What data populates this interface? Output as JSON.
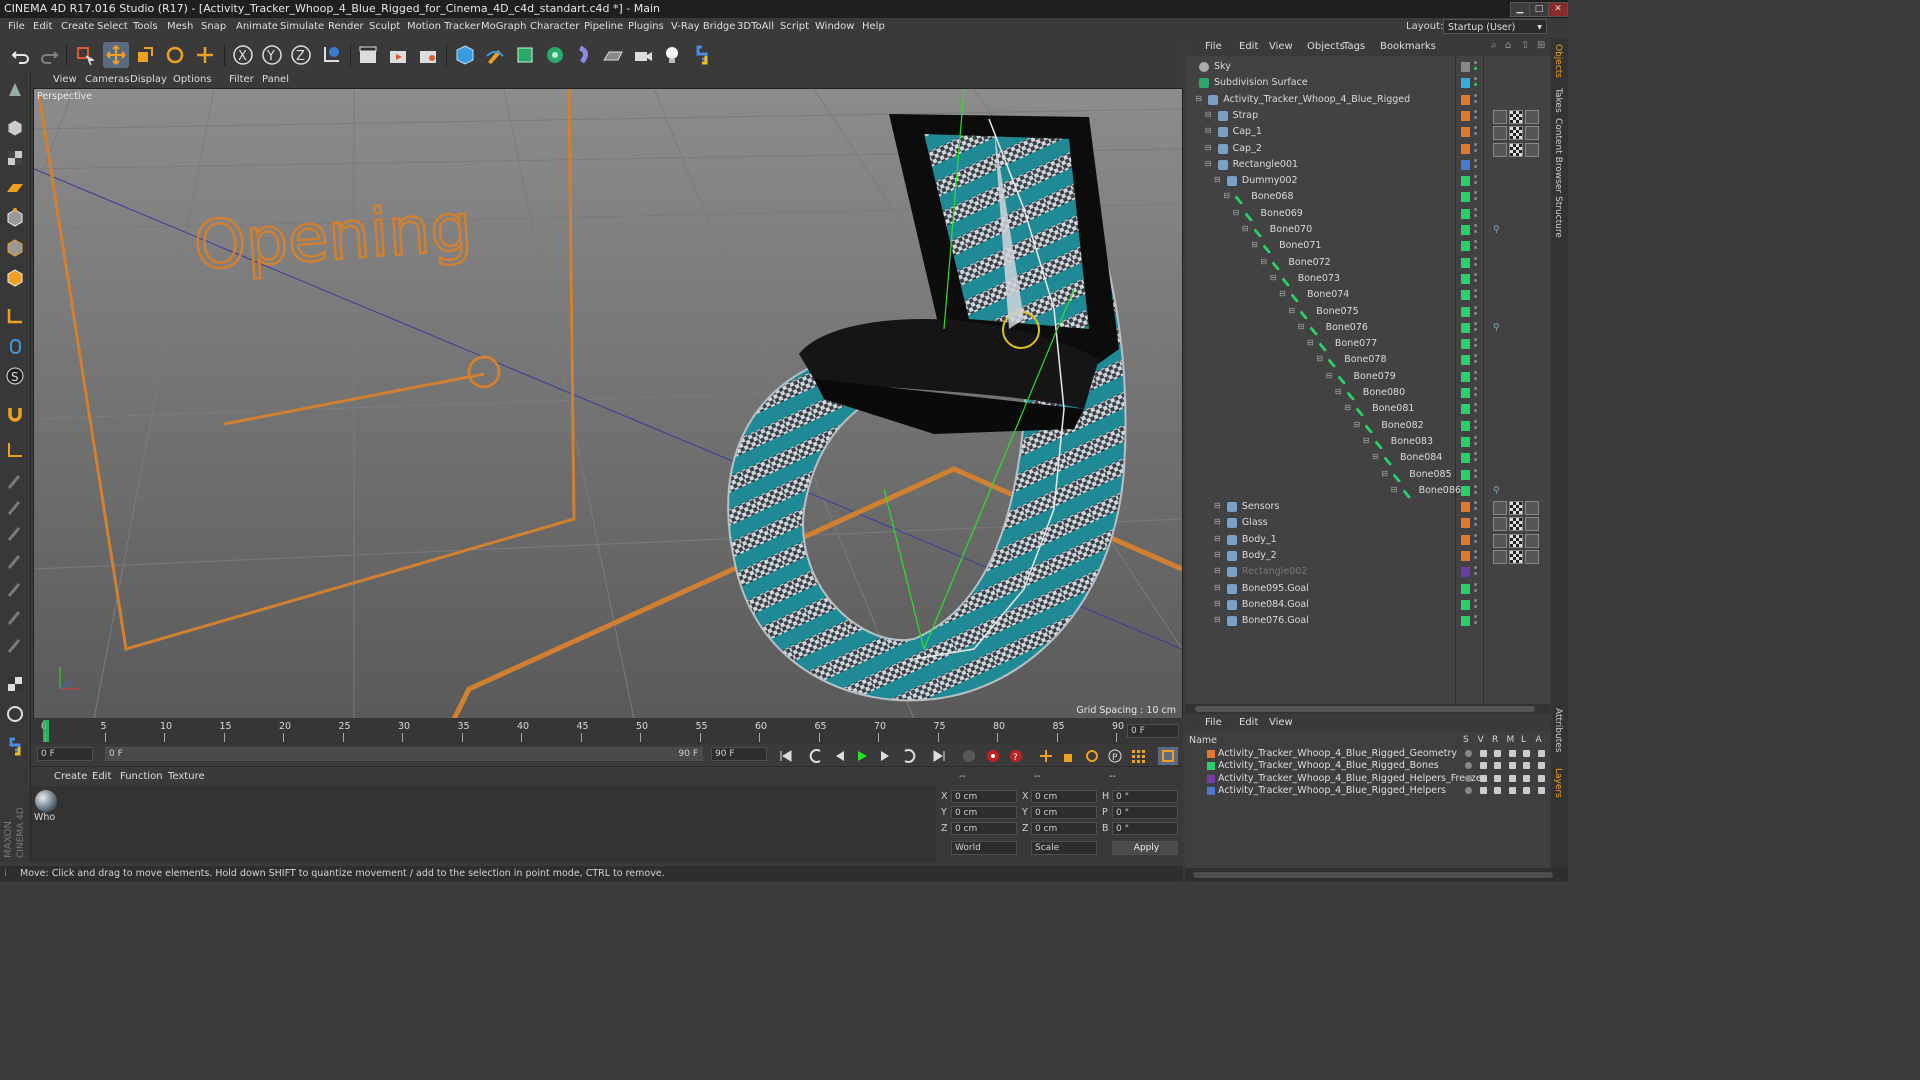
{
  "window": {
    "title": "CINEMA 4D R17.016 Studio (R17) - [Activity_Tracker_Whoop_4_Blue_Rigged_for_Cinema_4D_c4d_standart.c4d *] - Main"
  },
  "menu": [
    "File",
    "Edit",
    "Create",
    "Select",
    "Tools",
    "Mesh",
    "Snap",
    "Animate",
    "Simulate",
    "Render",
    "Sculpt",
    "Motion Tracker",
    "MoGraph",
    "Character",
    "Pipeline",
    "Plugins",
    "V-Ray Bridge",
    "3DToAll",
    "Script",
    "Window",
    "Help"
  ],
  "layout": {
    "label": "Layout:",
    "value": "Startup (User)"
  },
  "viewport_menu": [
    "View",
    "Cameras",
    "Display",
    "Options",
    "Filter",
    "Panel"
  ],
  "viewport": {
    "label": "Perspective",
    "grid_spacing": "Grid Spacing : 10 cm",
    "scene_text": "Opening"
  },
  "timeline": {
    "ticks": [
      "0",
      "5",
      "10",
      "15",
      "20",
      "25",
      "30",
      "35",
      "40",
      "45",
      "50",
      "55",
      "60",
      "65",
      "70",
      "75",
      "80",
      "85",
      "90"
    ],
    "frame_end": "0 F"
  },
  "playbar": {
    "current": "0 F",
    "range_start": "0 F",
    "range_end": "90 F",
    "max": "90 F"
  },
  "material_menu": [
    "Create",
    "Edit",
    "Function",
    "Texture"
  ],
  "material": {
    "name": "Who"
  },
  "coords": {
    "dashes": [
      "--",
      "--",
      "--"
    ],
    "rows": [
      {
        "a": "X",
        "av": "0 cm",
        "b": "X",
        "bv": "0 cm",
        "c": "H",
        "cv": "0 °"
      },
      {
        "a": "Y",
        "av": "0 cm",
        "b": "Y",
        "bv": "0 cm",
        "c": "P",
        "cv": "0 °"
      },
      {
        "a": "Z",
        "av": "0 cm",
        "b": "Z",
        "bv": "0 cm",
        "c": "B",
        "cv": "0 °"
      }
    ],
    "world": "World",
    "scale": "Scale",
    "apply": "Apply"
  },
  "status": "Move: Click and drag to move elements. Hold down SHIFT to quantize movement / add to the selection in point mode, CTRL to remove.",
  "object_menu": [
    "File",
    "Edit",
    "View",
    "Objects",
    "Tags",
    "Bookmarks"
  ],
  "objects": [
    {
      "name": "Sky",
      "indent": 0,
      "icon": "sky-icon",
      "color": "#888"
    },
    {
      "name": "Subdivision Surface",
      "indent": 0,
      "icon": "subdivision-icon",
      "color": "#3aa8e0"
    },
    {
      "name": "Activity_Tracker_Whoop_4_Blue_Rigged",
      "indent": 1,
      "icon": "null-icon",
      "color": "#e07a2a"
    },
    {
      "name": "Strap",
      "indent": 2,
      "icon": "polygon-icon",
      "color": "#e07a2a"
    },
    {
      "name": "Cap_1",
      "indent": 2,
      "icon": "polygon-icon",
      "color": "#e07a2a"
    },
    {
      "name": "Cap_2",
      "indent": 2,
      "icon": "polygon-icon",
      "color": "#e07a2a"
    },
    {
      "name": "Rectangle001",
      "indent": 2,
      "icon": "spline-icon",
      "color": "#4a7ad0"
    },
    {
      "name": "Dummy002",
      "indent": 3,
      "icon": "null-icon",
      "color": "#2ad06a"
    },
    {
      "name": "Bone068",
      "indent": 4,
      "icon": "bone-icon",
      "color": "#2ad06a"
    },
    {
      "name": "Bone069",
      "indent": 5,
      "icon": "bone-icon",
      "color": "#2ad06a"
    },
    {
      "name": "Bone070",
      "indent": 6,
      "icon": "bone-icon",
      "color": "#2ad06a"
    },
    {
      "name": "Bone071",
      "indent": 7,
      "icon": "bone-icon",
      "color": "#2ad06a"
    },
    {
      "name": "Bone072",
      "indent": 8,
      "icon": "bone-icon",
      "color": "#2ad06a"
    },
    {
      "name": "Bone073",
      "indent": 9,
      "icon": "bone-icon",
      "color": "#2ad06a"
    },
    {
      "name": "Bone074",
      "indent": 10,
      "icon": "bone-icon",
      "color": "#2ad06a"
    },
    {
      "name": "Bone075",
      "indent": 11,
      "icon": "bone-icon",
      "color": "#2ad06a"
    },
    {
      "name": "Bone076",
      "indent": 12,
      "icon": "bone-icon",
      "color": "#2ad06a"
    },
    {
      "name": "Bone077",
      "indent": 13,
      "icon": "bone-icon",
      "color": "#2ad06a"
    },
    {
      "name": "Bone078",
      "indent": 14,
      "icon": "bone-icon",
      "color": "#2ad06a"
    },
    {
      "name": "Bone079",
      "indent": 15,
      "icon": "bone-icon",
      "color": "#2ad06a"
    },
    {
      "name": "Bone080",
      "indent": 16,
      "icon": "bone-icon",
      "color": "#2ad06a"
    },
    {
      "name": "Bone081",
      "indent": 17,
      "icon": "bone-icon",
      "color": "#2ad06a"
    },
    {
      "name": "Bone082",
      "indent": 18,
      "icon": "bone-icon",
      "color": "#2ad06a"
    },
    {
      "name": "Bone083",
      "indent": 19,
      "icon": "bone-icon",
      "color": "#2ad06a"
    },
    {
      "name": "Bone084",
      "indent": 20,
      "icon": "bone-icon",
      "color": "#2ad06a"
    },
    {
      "name": "Bone085",
      "indent": 21,
      "icon": "bone-icon",
      "color": "#2ad06a"
    },
    {
      "name": "Bone086",
      "indent": 22,
      "icon": "bone-icon",
      "color": "#2ad06a"
    },
    {
      "name": "Sensors",
      "indent": 3,
      "icon": "polygon-icon",
      "color": "#e07a2a"
    },
    {
      "name": "Glass",
      "indent": 3,
      "icon": "polygon-icon",
      "color": "#e07a2a"
    },
    {
      "name": "Body_1",
      "indent": 3,
      "icon": "polygon-icon",
      "color": "#e07a2a"
    },
    {
      "name": "Body_2",
      "indent": 3,
      "icon": "polygon-icon",
      "color": "#e07a2a"
    },
    {
      "name": "Rectangle002",
      "indent": 3,
      "icon": "spline-icon",
      "color": "#6a3aa8",
      "dim": true
    },
    {
      "name": "Bone095.Goal",
      "indent": 3,
      "icon": "null-icon",
      "color": "#2ad06a"
    },
    {
      "name": "Bone084.Goal",
      "indent": 3,
      "icon": "null-icon",
      "color": "#2ad06a"
    },
    {
      "name": "Bone076.Goal",
      "indent": 3,
      "icon": "null-icon",
      "color": "#2ad06a"
    }
  ],
  "layer_menu": [
    "File",
    "Edit",
    "View"
  ],
  "layer_header": {
    "name": "Name",
    "cols": [
      "S",
      "V",
      "R",
      "M",
      "L",
      "A"
    ]
  },
  "layers": [
    {
      "name": "Activity_Tracker_Whoop_4_Blue_Rigged_Geometry",
      "color": "#e07a2a"
    },
    {
      "name": "Activity_Tracker_Whoop_4_Blue_Rigged_Bones",
      "color": "#2ad06a"
    },
    {
      "name": "Activity_Tracker_Whoop_4_Blue_Rigged_Helpers_Freeze",
      "color": "#7a3aa8"
    },
    {
      "name": "Activity_Tracker_Whoop_4_Blue_Rigged_Helpers",
      "color": "#4a7ad0"
    }
  ],
  "right_tabs": [
    "Objects",
    "Takes",
    "Content Browser",
    "Structure",
    "Attributes",
    "Layers"
  ]
}
